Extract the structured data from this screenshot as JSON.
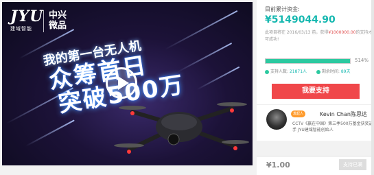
{
  "video": {
    "brand_logo": "JYU",
    "brand_sub": "建域智能",
    "partner_line1": "中兴",
    "partner_line2": "微品",
    "headline_line1": "我的第一台无人机",
    "headline_line2": "众筹首日",
    "headline_line3": "突破500万",
    "play_icon": "play-icon"
  },
  "funding": {
    "raised_label": "目前累计资金:",
    "raised_amount": "¥5149044.90",
    "deadline_prefix": "此项目将在 2016/03/13 前，获得",
    "goal_amount": "¥1000000.00",
    "deadline_suffix": "的支持才可成功!",
    "progress_percent": 514,
    "progress_text": "514%",
    "supporters_label": "支持人数:",
    "supporters_value": "21871人",
    "days_left_label": "剩余时间:",
    "days_left_value": "89天"
  },
  "support_button_label": "我要支持",
  "sponsor": {
    "badge": "发起人",
    "name": "Kevin Chan陈思达",
    "desc": "CCTV《赢在中国》第三季500万基金获奖选手 JYU建域智能创始人"
  },
  "tier": {
    "price": "¥1.00",
    "button_label": "支持已满"
  }
}
